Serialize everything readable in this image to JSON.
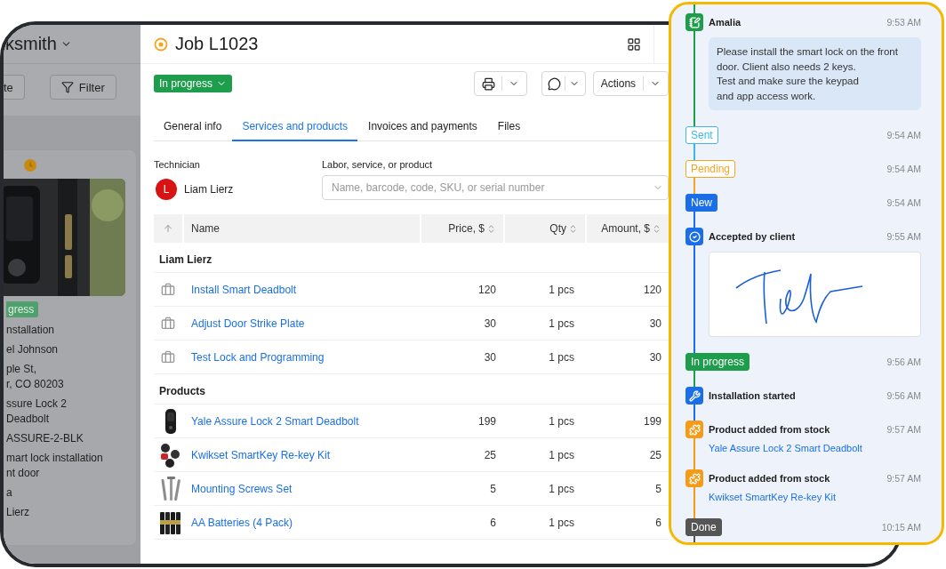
{
  "sidebar": {
    "title": "ksmith",
    "buttons": [
      {
        "label": "te",
        "kind": "plain"
      },
      {
        "label": "Filter",
        "kind": "filter"
      }
    ],
    "card": {
      "status": "gress",
      "fields": [
        [
          "nstallation"
        ],
        [
          "el Johnson"
        ],
        [
          "ple St,",
          "r, CO 80203"
        ],
        [
          "ssure Lock 2",
          "Deadbolt"
        ],
        [
          "ASSURE-2-BLK"
        ],
        [
          "mart lock installation",
          "nt door"
        ],
        [
          "a"
        ],
        [
          "Lierz"
        ]
      ]
    }
  },
  "job": {
    "title": "Job L1023",
    "status": "In progress",
    "actions": "Actions"
  },
  "tabs": [
    {
      "label": "General info",
      "selected": false
    },
    {
      "label": "Services and products",
      "selected": true
    },
    {
      "label": "Invoices and payments",
      "selected": false
    },
    {
      "label": "Files",
      "selected": false
    }
  ],
  "technician": {
    "label": "Technician",
    "initial": "L",
    "name": "Liam Lierz"
  },
  "product_field": {
    "label": "Labor, service, or product",
    "placeholder": "Name, barcode, code, SKU, or serial number"
  },
  "table": {
    "columns": [
      "Name",
      "Price, $",
      "Qty",
      "Amount, $"
    ],
    "groups": [
      {
        "title": "Liam Lierz",
        "kind": "service",
        "rows": [
          {
            "name": "Install Smart Deadbolt",
            "price": "120",
            "qty": "1 pcs",
            "amount": "120"
          },
          {
            "name": "Adjust Door Strike Plate",
            "price": "30",
            "qty": "1 pcs",
            "amount": "30"
          },
          {
            "name": "Test Lock and Programming",
            "price": "30",
            "qty": "1 pcs",
            "amount": "30"
          }
        ]
      },
      {
        "title": "Products",
        "kind": "product",
        "rows": [
          {
            "name": "Yale Assure Lock 2 Smart Deadbolt",
            "price": "199",
            "qty": "1 pcs",
            "amount": "199"
          },
          {
            "name": "Kwikset SmartKey Re-key Kit",
            "price": "25",
            "qty": "1 pcs",
            "amount": "25"
          },
          {
            "name": "Mounting Screws Set",
            "price": "5",
            "qty": "1 pcs",
            "amount": "5"
          },
          {
            "name": "AA Batteries (4 Pack)",
            "price": "6",
            "qty": "1 pcs",
            "amount": "6"
          }
        ]
      }
    ]
  },
  "timeline": [
    {
      "kind": "message",
      "author": "Amalia",
      "time": "9:53 AM",
      "text": "Please install the smart lock on the front\ndoor. Client also needs 2 keys.\nTest and make sure the keypad\nand app access work.",
      "color": "#1e9e4c"
    },
    {
      "kind": "status",
      "label": "Sent",
      "filled": false,
      "time": "9:54 AM",
      "color": "#3ab7ef"
    },
    {
      "kind": "status",
      "label": "Pending",
      "filled": false,
      "time": "9:54 AM",
      "color": "#f5a524"
    },
    {
      "kind": "status",
      "label": "New",
      "filled": true,
      "time": "9:54 AM",
      "color": "#1a6fe8"
    },
    {
      "kind": "signature",
      "title": "Accepted by client",
      "time": "9:55 AM",
      "color": "#1a6fe8"
    },
    {
      "kind": "status",
      "label": "In progress",
      "filled": true,
      "time": "9:56 AM",
      "color": "#1e9e4c"
    },
    {
      "kind": "task",
      "title": "Installation started",
      "time": "9:56 AM",
      "color": "#1a6fe8"
    },
    {
      "kind": "stock",
      "title": "Product added from stock",
      "link": "Yale Assure Lock 2 Smart Deadbolt",
      "time": "9:57 AM",
      "color": "#f59b17"
    },
    {
      "kind": "stock",
      "title": "Product added from stock",
      "link": "Kwikset SmartKey Re-key Kit",
      "time": "9:57 AM",
      "color": "#f59b17"
    },
    {
      "kind": "status",
      "label": "Done",
      "filled": true,
      "time": "10:15 AM",
      "color": "#555555"
    }
  ]
}
